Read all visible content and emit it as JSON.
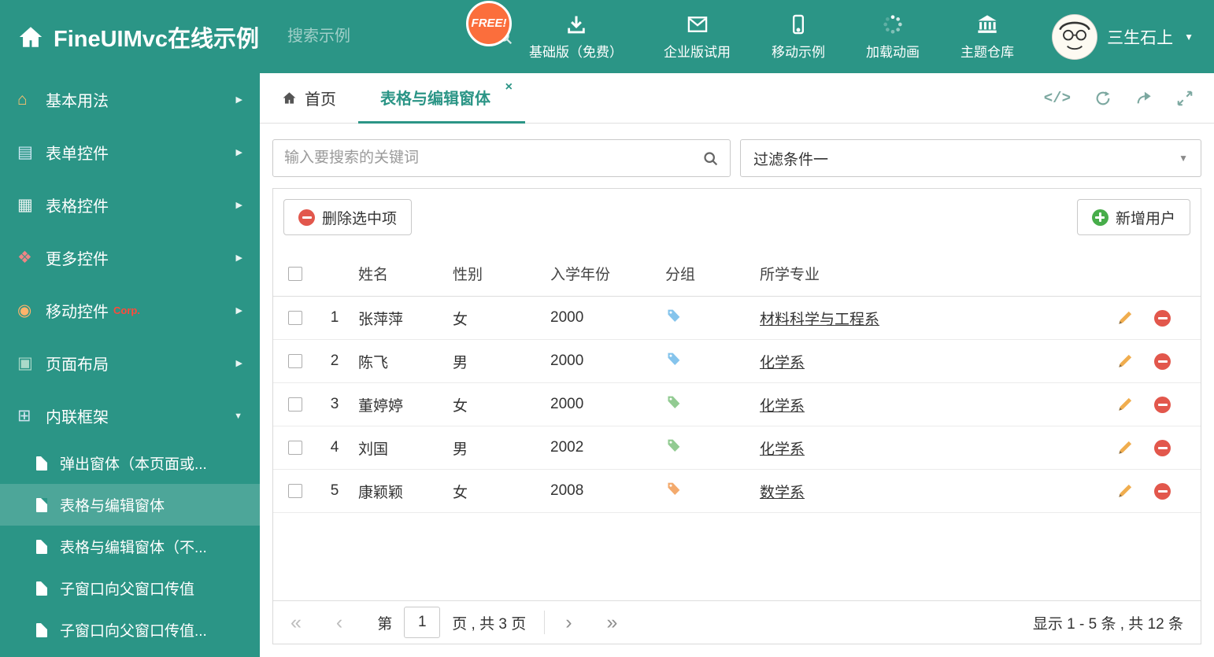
{
  "colors": {
    "theme": "#2b9586",
    "free_badge_bg": "#fb6e3c",
    "delete_red": "#e2574c",
    "add_green": "#47ad4a",
    "pencil": "#f0ad4e"
  },
  "icons": {
    "chevron_right": "▶",
    "chevron_down": "▼",
    "caret_down": "▼",
    "close": "×",
    "code": "</>",
    "pager_first": "«",
    "pager_prev": "‹",
    "pager_next": "›",
    "pager_last": "»"
  },
  "header": {
    "title": "FineUIMvc在线示例",
    "search_placeholder": "搜索示例",
    "free_badge": "FREE!",
    "nav": [
      {
        "label": "基础版（免费）"
      },
      {
        "label": "企业版试用"
      },
      {
        "label": "移动示例"
      },
      {
        "label": "加载动画"
      },
      {
        "label": "主题仓库"
      }
    ],
    "user_name": "三生石上"
  },
  "sidebar": {
    "items": [
      {
        "label": "基本用法",
        "glyph": "⌂",
        "glyph_color": "#ffc06e",
        "chevron": "▶"
      },
      {
        "label": "表单控件",
        "glyph": "▤",
        "glyph_color": "#cfe9f5",
        "chevron": "▶"
      },
      {
        "label": "表格控件",
        "glyph": "▦",
        "glyph_color": "#e8f3f1",
        "chevron": "▶"
      },
      {
        "label": "更多控件",
        "glyph": "❖",
        "glyph_color": "#ef8585",
        "chevron": "▶"
      },
      {
        "label": "移动控件",
        "badge": "Corp.",
        "glyph": "◉",
        "glyph_color": "#ffb36b",
        "chevron": "▶"
      },
      {
        "label": "页面布局",
        "glyph": "▣",
        "glyph_color": "#a9d9c9",
        "chevron": "▶"
      },
      {
        "label": "内联框架",
        "glyph": "⊞",
        "glyph_color": "#cfe3ef",
        "chevron": "▼"
      }
    ],
    "subitems": [
      {
        "label": "弹出窗体（本页面或..."
      },
      {
        "label": "表格与编辑窗体"
      },
      {
        "label": "表格与编辑窗体（不..."
      },
      {
        "label": "子窗口向父窗口传值"
      },
      {
        "label": "子窗口向父窗口传值..."
      }
    ]
  },
  "tabs": {
    "home": "首页",
    "active": "表格与编辑窗体"
  },
  "content": {
    "search_placeholder": "输入要搜索的关键词",
    "filter_value": "过滤条件一",
    "delete_button": "删除选中项",
    "add_button": "新增用户",
    "table": {
      "headers": {
        "name": "姓名",
        "gender": "性别",
        "year": "入学年份",
        "group": "分组",
        "major": "所学专业"
      },
      "rows": [
        {
          "num": "1",
          "name": "张萍萍",
          "gender": "女",
          "year": "2000",
          "tag_color": "#85c4ec",
          "major": "材料科学与工程系"
        },
        {
          "num": "2",
          "name": "陈飞",
          "gender": "男",
          "year": "2000",
          "tag_color": "#85c4ec",
          "major": "化学系"
        },
        {
          "num": "3",
          "name": "董婷婷",
          "gender": "女",
          "year": "2000",
          "tag_color": "#92cb92",
          "major": "化学系"
        },
        {
          "num": "4",
          "name": "刘国",
          "gender": "男",
          "year": "2002",
          "tag_color": "#92cb92",
          "major": "化学系"
        },
        {
          "num": "5",
          "name": "康颖颖",
          "gender": "女",
          "year": "2008",
          "tag_color": "#f3aa6d",
          "major": "数学系"
        }
      ]
    },
    "pagination": {
      "label_page": "第",
      "current_page": "1",
      "label_total": "页 , 共 3 页",
      "summary": "显示 1 - 5 条 , 共 12 条"
    }
  }
}
